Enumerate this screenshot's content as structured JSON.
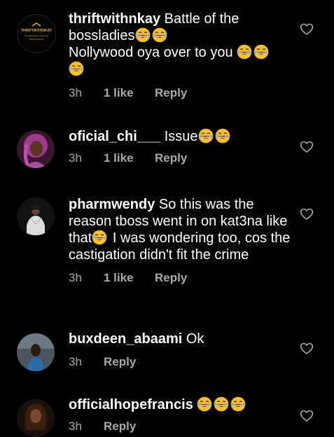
{
  "comments": [
    {
      "username": "thriftwithnkay",
      "text_before": " Battle of the bossladies",
      "emojis_1": "😂😂",
      "text_mid": "Nollywood oya over to you ",
      "emojis_2": "😂😂",
      "emojis_3": "😂",
      "time": "3h",
      "likes": "1 like",
      "reply": "Reply",
      "avatar_lines": [
        "THRIFTWITHNKAY",
        "Everything for everyone",
        "Thrift & luxury"
      ]
    },
    {
      "username": "oficial_chi___",
      "text": " Issue",
      "emojis": "😂😂",
      "time": "3h",
      "likes": "1 like",
      "reply": "Reply"
    },
    {
      "username": "pharmwendy",
      "text_before": " So this was the reason tboss went in on kat3na like that",
      "emojis": "😂",
      "text_after": " I was wondering too, cos the castigation didn't fit the crime",
      "time": "3h",
      "likes": "1 like",
      "reply": "Reply"
    },
    {
      "username": "buxdeen_abaami",
      "text": " Ok",
      "time": "3h",
      "reply": "Reply"
    },
    {
      "username": "officialhopefrancis",
      "emojis": "😂😂😂",
      "time": "3h",
      "reply": "Reply"
    }
  ],
  "icons": {
    "like": "heart-outline-icon",
    "emoji": "face-with-tears-of-joy-icon"
  },
  "colors": {
    "background": "#000000",
    "text": "#ffffff",
    "meta": "#a8a8a8"
  }
}
